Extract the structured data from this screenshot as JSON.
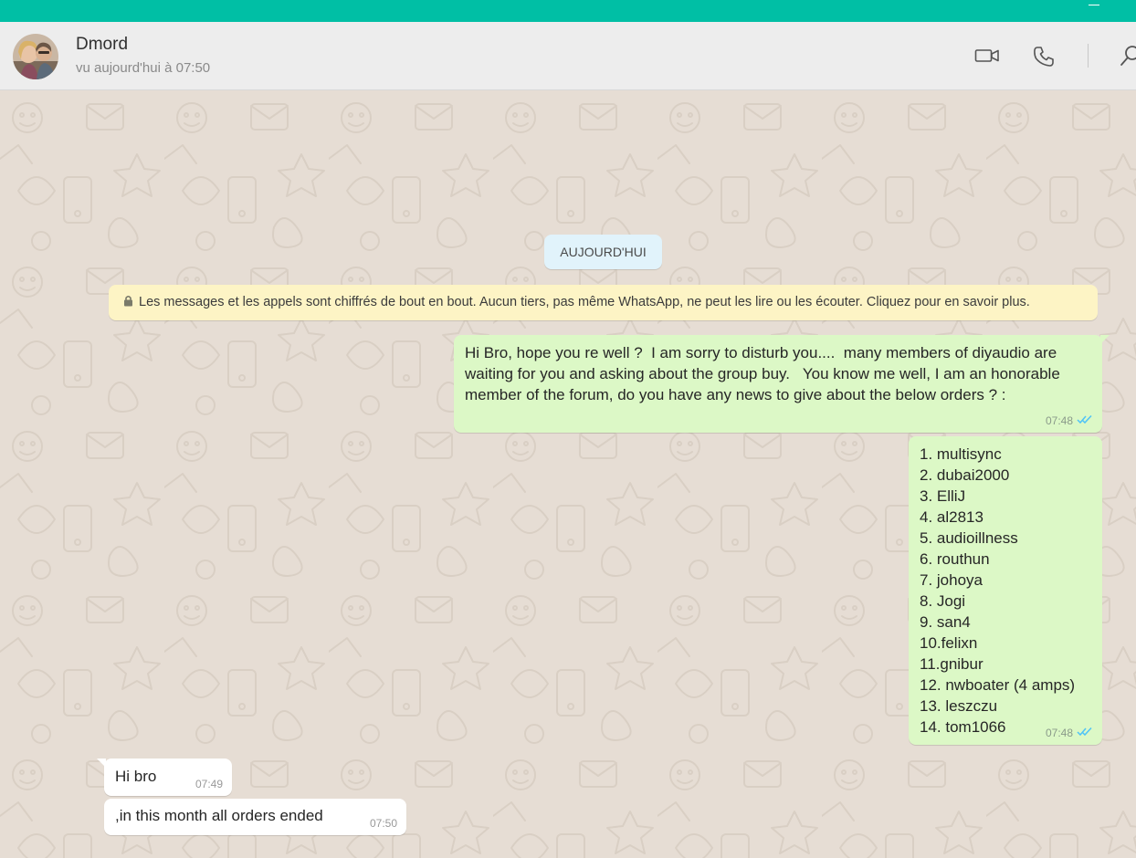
{
  "window": {
    "accent_color": "#00bfa5",
    "controls": {
      "minimize_icon": "minimize-icon"
    }
  },
  "header": {
    "contact_name": "Dmord",
    "contact_status": "vu aujourd'hui à 07:50",
    "icons": [
      "video-call-icon",
      "phone-icon",
      "search-icon"
    ]
  },
  "chat": {
    "date_chip": "AUJOURD'HUI",
    "encryption_notice": "Les messages et les appels sont chiffrés de bout en bout. Aucun tiers, pas même WhatsApp, ne peut les lire ou les écouter. Cliquez pour en savoir plus.",
    "messages": [
      {
        "direction": "outgoing",
        "text": "Hi Bro, hope you re well ?  I am sorry to disturb you....  many members of diyaudio are waiting for you and asking about the group buy.   You know me well, I am an honorable member of the forum, do you have any news to give about the below orders ? :",
        "time": "07:48",
        "status_icon": "double-check-icon"
      },
      {
        "direction": "outgoing",
        "list": [
          "1. multisync",
          "2. dubai2000",
          "3. ElliJ",
          "4. al2813",
          "5. audioillness",
          "6. routhun",
          "7. johoya",
          "8. Jogi",
          "9. san4",
          "10.felixn",
          "11.gnibur",
          "12. nwboater (4 amps)",
          "13. leszczu",
          "14. tom1066"
        ],
        "time": "07:48",
        "status_icon": "double-check-icon"
      },
      {
        "direction": "incoming",
        "text": "Hi bro",
        "time": "07:49"
      },
      {
        "direction": "incoming",
        "text": ",in this month all orders ended",
        "time": "07:50"
      }
    ],
    "colors": {
      "background": "#e6ddd4",
      "outgoing_bubble": "#dcf8c6",
      "incoming_bubble": "#ffffff",
      "date_chip": "#e1f3fb",
      "encryption_notice": "#fdf4c5",
      "read_ticks": "#4fc3f7"
    }
  }
}
